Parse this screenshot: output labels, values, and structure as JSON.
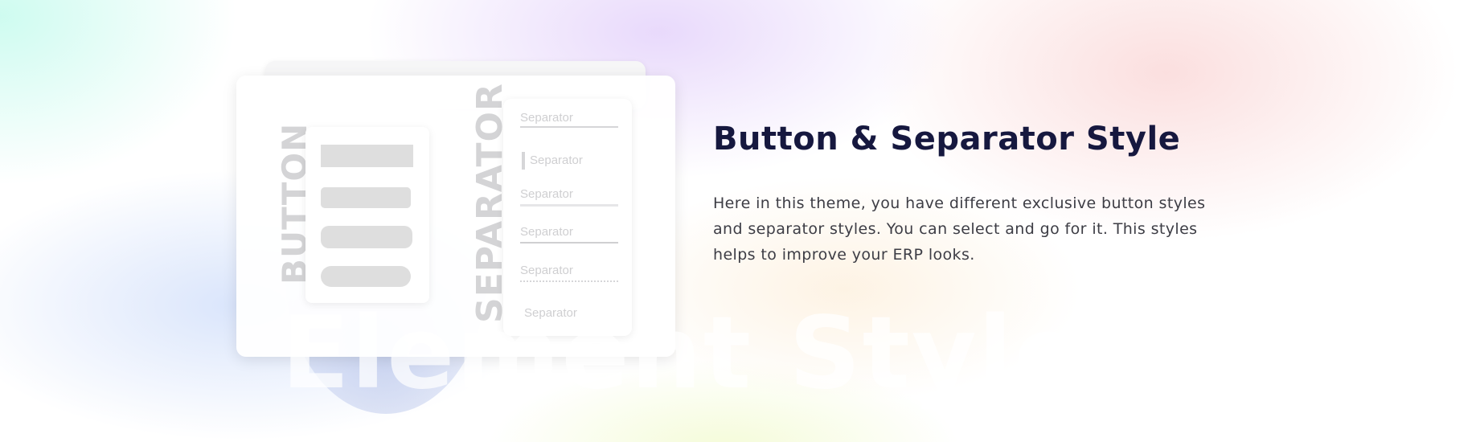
{
  "headline": {
    "title": "Button & Separator Style",
    "description": "Here in this theme, you have different exclusive button styles and separator styles. You can select and go for it. This styles helps to improve your ERP looks."
  },
  "watermark": "Element Style",
  "preview": {
    "button_label": "BUTTON",
    "separator_label": "SEPARATOR",
    "separator_samples": [
      "Separator",
      "Separator",
      "Separator",
      "Separator",
      "Separator",
      "Separator"
    ]
  },
  "colors": {
    "title": "#16183f",
    "body_text": "#3d3d45",
    "placeholder_gray": "#dedede"
  }
}
